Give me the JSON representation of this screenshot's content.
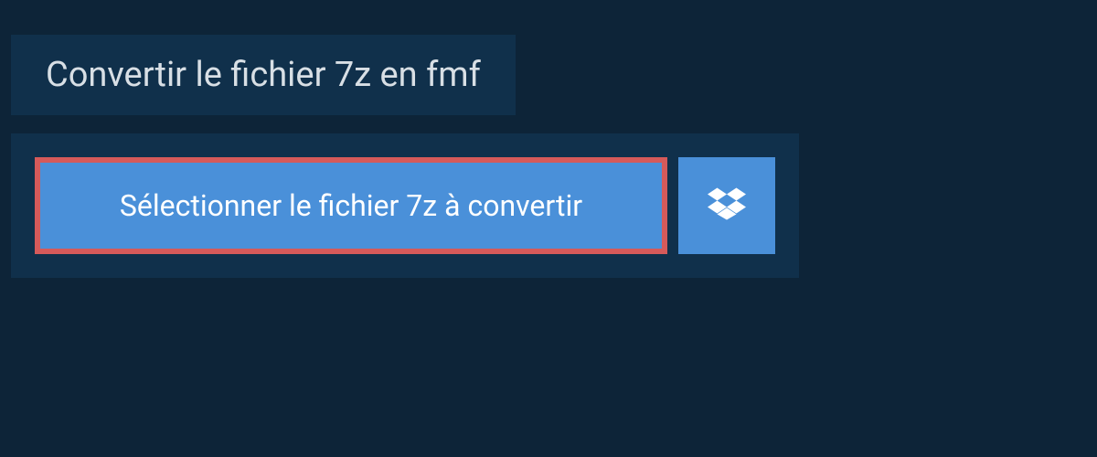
{
  "header": {
    "title": "Convertir le fichier 7z en fmf"
  },
  "upload": {
    "select_button_label": "Sélectionner le fichier 7z à convertir",
    "dropbox_icon": "dropbox-icon"
  }
}
